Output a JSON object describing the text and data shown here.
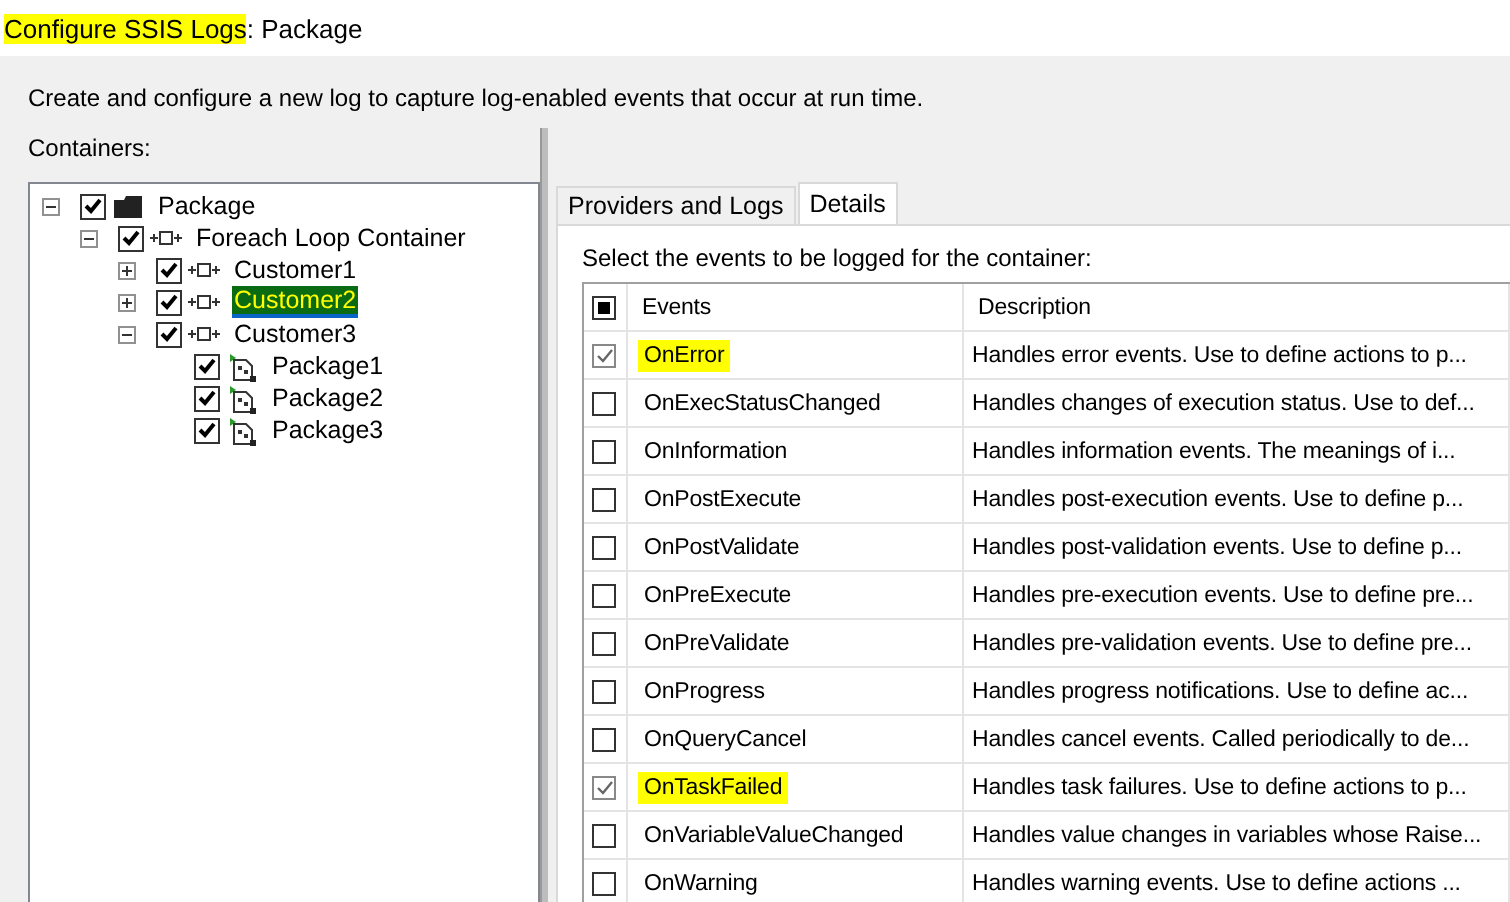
{
  "window": {
    "title_highlighted": "Configure SSIS Logs",
    "title_rest": ": Package"
  },
  "intro": "Create and configure a new log to capture log-enabled events that occur at run time.",
  "containers": {
    "label": "Containers:",
    "tree": [
      {
        "label": "Package",
        "kind": "package",
        "checked": true,
        "expanded": true,
        "selected": false,
        "children": [
          {
            "label": "Foreach Loop Container",
            "kind": "loop",
            "checked": true,
            "expanded": true,
            "selected": false,
            "children": [
              {
                "label": "Customer1",
                "kind": "loop",
                "checked": true,
                "expanded": false,
                "selected": false
              },
              {
                "label": "Customer2",
                "kind": "loop",
                "checked": true,
                "expanded": false,
                "selected": true
              },
              {
                "label": "Customer3",
                "kind": "loop",
                "checked": true,
                "expanded": true,
                "selected": false,
                "children": [
                  {
                    "label": "Package1",
                    "kind": "task",
                    "checked": true,
                    "selected": false
                  },
                  {
                    "label": "Package2",
                    "kind": "task",
                    "checked": true,
                    "selected": false
                  },
                  {
                    "label": "Package3",
                    "kind": "task",
                    "checked": true,
                    "selected": false
                  }
                ]
              }
            ]
          }
        ]
      }
    ]
  },
  "tabs": [
    {
      "label": "Providers and Logs",
      "selected": false
    },
    {
      "label": "Details",
      "selected": true
    }
  ],
  "details": {
    "label": "Select the events to be logged for the container:",
    "columns": [
      "Events",
      "Description"
    ],
    "header_indeterminate": true,
    "rows": [
      {
        "event": "OnError",
        "description": "Handles error events. Use to define actions to p...",
        "checked": true,
        "highlighted": true
      },
      {
        "event": "OnExecStatusChanged",
        "description": "Handles changes of execution status. Use to def...",
        "checked": false,
        "highlighted": false
      },
      {
        "event": "OnInformation",
        "description": "Handles information events. The meanings of i...",
        "checked": false,
        "highlighted": false
      },
      {
        "event": "OnPostExecute",
        "description": "Handles post-execution events. Use to define p...",
        "checked": false,
        "highlighted": false
      },
      {
        "event": "OnPostValidate",
        "description": "Handles post-validation events. Use to define p...",
        "checked": false,
        "highlighted": false
      },
      {
        "event": "OnPreExecute",
        "description": "Handles pre-execution events. Use to define pre...",
        "checked": false,
        "highlighted": false
      },
      {
        "event": "OnPreValidate",
        "description": "Handles pre-validation events. Use to define pre...",
        "checked": false,
        "highlighted": false
      },
      {
        "event": "OnProgress",
        "description": "Handles progress notifications. Use to define ac...",
        "checked": false,
        "highlighted": false
      },
      {
        "event": "OnQueryCancel",
        "description": "Handles cancel events. Called periodically to de...",
        "checked": false,
        "highlighted": false
      },
      {
        "event": "OnTaskFailed",
        "description": "Handles task failures. Use to define actions to p...",
        "checked": true,
        "highlighted": true
      },
      {
        "event": "OnVariableValueChanged",
        "description": "Handles value changes in variables whose Raise...",
        "checked": false,
        "highlighted": false
      },
      {
        "event": "OnWarning",
        "description": "Handles warning events. Use to define actions ...",
        "checked": false,
        "highlighted": false
      }
    ]
  }
}
